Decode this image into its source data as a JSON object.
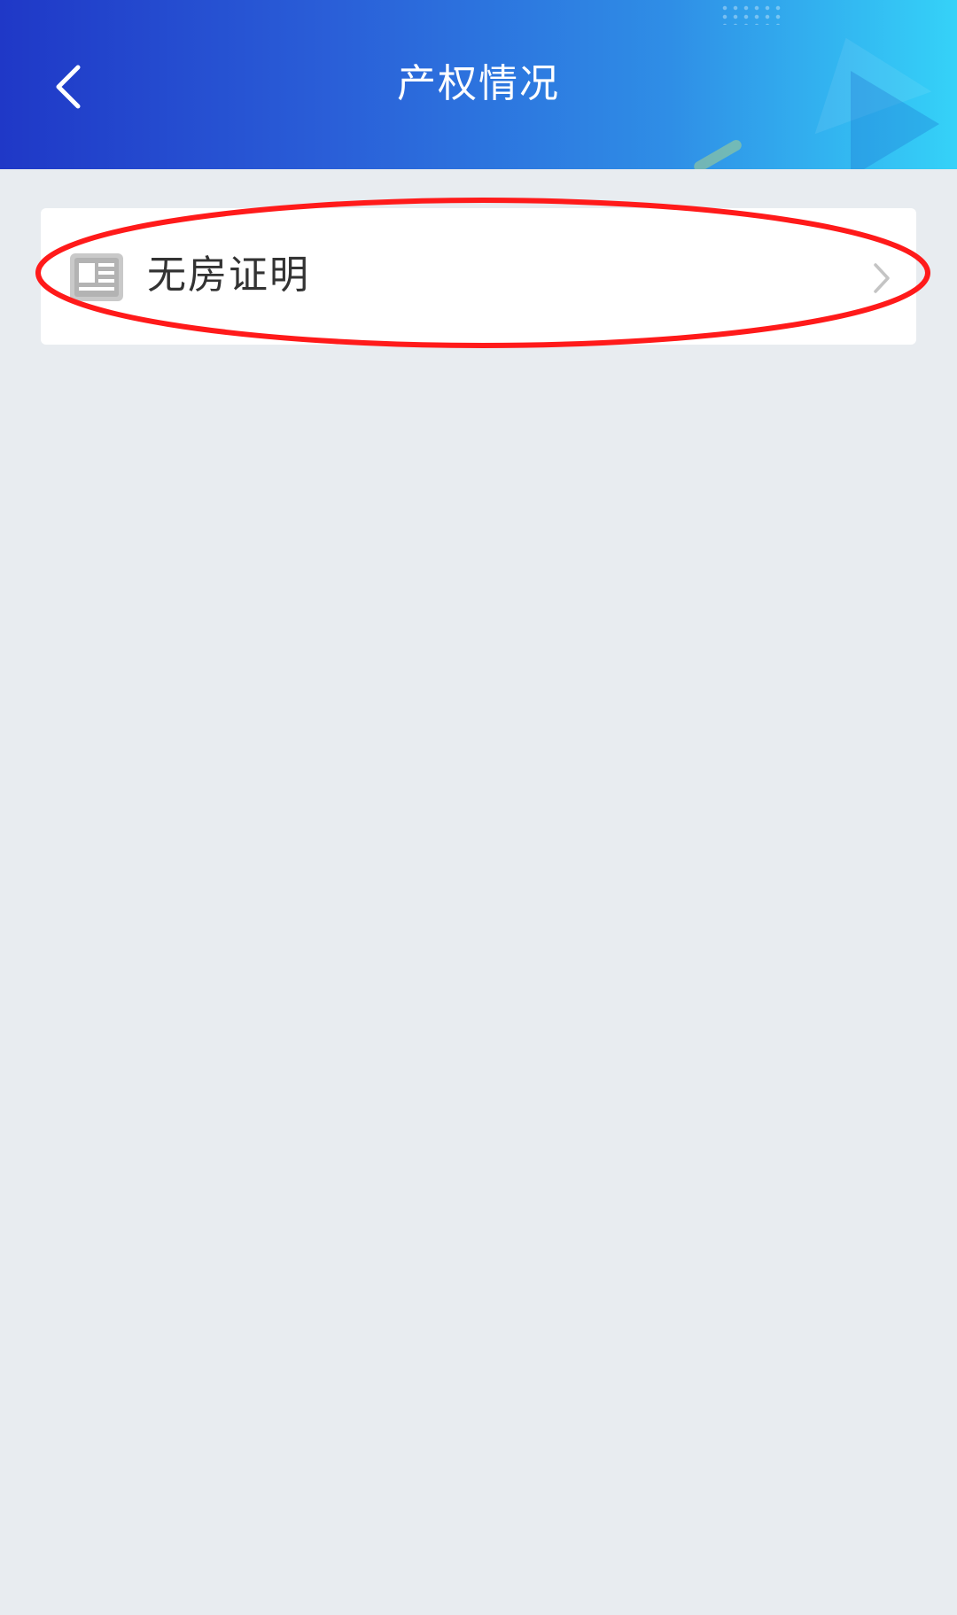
{
  "header": {
    "title": "产权情况",
    "back_icon": "chevron-left-icon",
    "gradient_start": "#1f38c7",
    "gradient_end": "#35d2f8"
  },
  "menu": {
    "items": [
      {
        "label": "无房证明",
        "icon": "document-icon",
        "trailing_icon": "chevron-right-icon"
      }
    ]
  },
  "annotation": {
    "type": "ellipse-highlight",
    "color": "#ff1a1a"
  },
  "colors": {
    "page_background": "#e8ecf0",
    "card_background": "#ffffff",
    "label_text": "#333333"
  }
}
